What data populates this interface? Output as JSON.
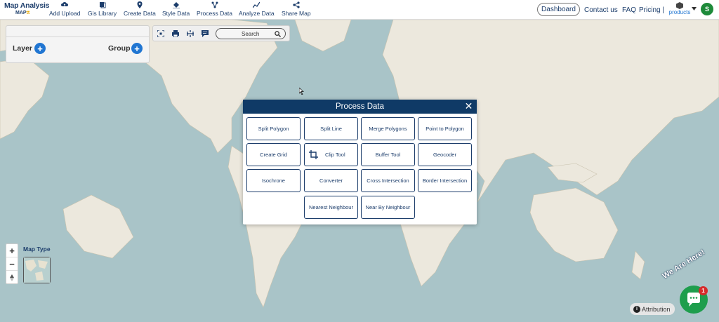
{
  "header": {
    "brand_title": "Map Analysis",
    "brand_sub_a": "MAP",
    "brand_sub_b": "tt",
    "nav": [
      {
        "label": "Add Upload",
        "icon": "cloud-upload-icon"
      },
      {
        "label": "Gis Library",
        "icon": "library-icon"
      },
      {
        "label": "Create Data",
        "icon": "map-pin-icon"
      },
      {
        "label": "Style Data",
        "icon": "paint-bucket-icon"
      },
      {
        "label": "Process Data",
        "icon": "process-icon"
      },
      {
        "label": "Analyze Data",
        "icon": "analyze-icon"
      },
      {
        "label": "Share Map",
        "icon": "share-icon"
      }
    ],
    "dashboard": "Dashboard",
    "contact": "Contact us",
    "faq": "FAQ",
    "pricing": "Pricing |",
    "products": "products",
    "avatar_initial": "S"
  },
  "layers_panel": {
    "layer_label": "Layer",
    "group_label": "Group"
  },
  "toolbar": {
    "search_label": "Search"
  },
  "modal": {
    "title": "Process Data",
    "buttons": [
      "Split Polygon",
      "Split Line",
      "Merge Polygons",
      "Point to Polygon",
      "Create Grid",
      "Clip Tool",
      "Buffer Tool",
      "Geocoder",
      "Isochrone",
      "Converter",
      "Cross Intersection",
      "Border Intersection",
      "Nearest Neighbour",
      "Near By Neighbour"
    ]
  },
  "map_controls": {
    "zoom_in": "+",
    "zoom_out": "−",
    "map_type_label": "Map Type",
    "attribution": "Attribution"
  },
  "chat": {
    "badge": "1",
    "tagline": "We Are Here!"
  },
  "colors": {
    "brand_navy": "#1c3d6b",
    "modal_header": "#0f3a66",
    "accent_blue": "#2176d2",
    "chat_green": "#1e9e4d",
    "ocean": "#a9c4c8",
    "land": "#ece8dd"
  }
}
